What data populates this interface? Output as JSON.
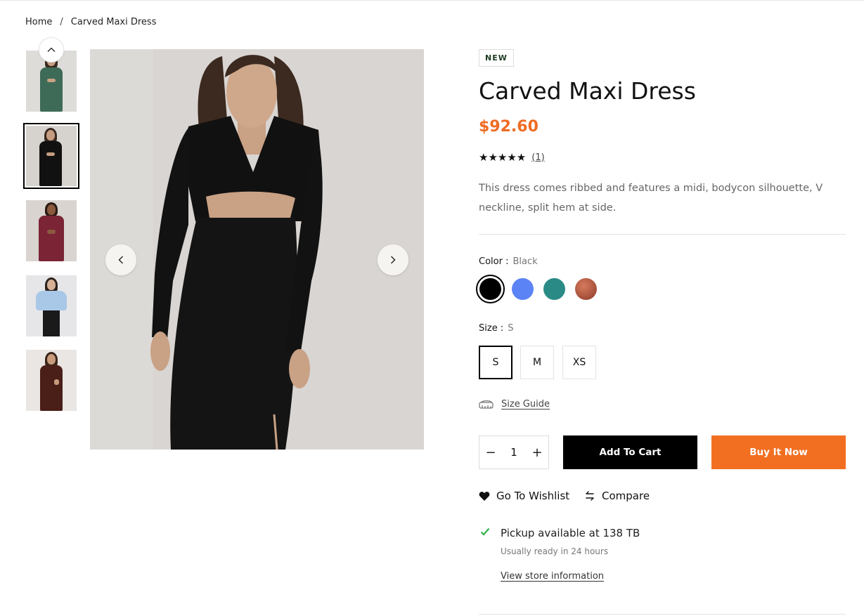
{
  "breadcrumb": {
    "home": "Home",
    "separator": "/",
    "current": "Carved Maxi Dress"
  },
  "gallery": {
    "thumbnails": [
      {
        "name": "green dress"
      },
      {
        "name": "black dress"
      },
      {
        "name": "burgundy dress"
      },
      {
        "name": "light blue top"
      },
      {
        "name": "brown dress"
      }
    ],
    "selected_index": 1,
    "prev_icon": "chevron-left-icon",
    "next_icon": "chevron-right-icon",
    "up_icon": "chevron-up-icon"
  },
  "product": {
    "badge": "NEW",
    "title": "Carved Maxi Dress",
    "price": "$92.60",
    "rating_stars": "★★★★★",
    "rating_value": 5,
    "rating_count": "(1)",
    "description": "This dress comes ribbed and features a midi, bodycon silhouette, V neckline, split hem at side."
  },
  "color": {
    "label": "Color :",
    "selected": "Black",
    "swatches": [
      "#000000",
      "#5b83f5",
      "#2a8a86",
      "#b9563b"
    ]
  },
  "size": {
    "label": "Size :",
    "selected": "S",
    "options": [
      "S",
      "M",
      "XS"
    ]
  },
  "size_guide": "Size Guide",
  "quantity": {
    "minus": "−",
    "value": "1",
    "plus": "+"
  },
  "buttons": {
    "add_to_cart": "Add To Cart",
    "buy_now": "Buy It Now"
  },
  "actions": {
    "wishlist": "Go To Wishlist",
    "compare": "Compare"
  },
  "pickup": {
    "title": "Pickup available at 138 TB",
    "subtitle": "Usually ready in 24 hours",
    "link": "View store information"
  },
  "colors": {
    "accent": "#ef6c24",
    "buy_button": "#f26f22",
    "check": "#2fb24c"
  }
}
